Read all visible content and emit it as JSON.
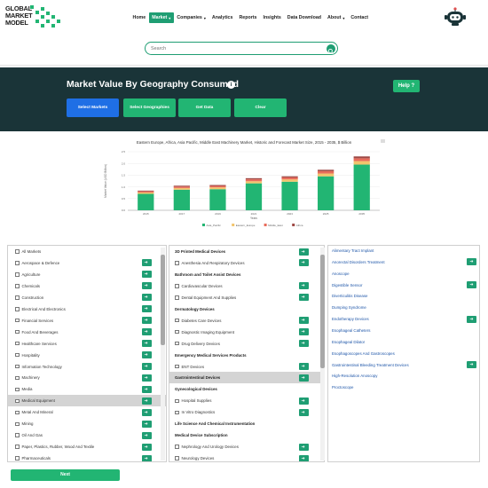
{
  "logo": {
    "line1": "GLOBAL",
    "line2": "MARKET",
    "line3": "MODEL"
  },
  "nav": [
    {
      "label": "Home",
      "dropdown": false,
      "active": false
    },
    {
      "label": "Market",
      "dropdown": true,
      "active": true
    },
    {
      "label": "Companies",
      "dropdown": true,
      "active": false
    },
    {
      "label": "Analytics",
      "dropdown": false,
      "active": false
    },
    {
      "label": "Reports",
      "dropdown": false,
      "active": false
    },
    {
      "label": "Insights",
      "dropdown": false,
      "active": false
    },
    {
      "label": "Data Download",
      "dropdown": false,
      "active": false
    },
    {
      "label": "About",
      "dropdown": true,
      "active": false
    },
    {
      "label": "Contact",
      "dropdown": false,
      "active": false
    }
  ],
  "search": {
    "placeholder": "Search",
    "value": ""
  },
  "banner": {
    "title": "Market Value By Geography Consumed",
    "info_icon": "i",
    "help_label": "Help",
    "help_icon": "?",
    "buttons": [
      {
        "label": "Select Markets",
        "color": "#1f6fe5"
      },
      {
        "label": "Select Geographies",
        "color": "#22b573"
      },
      {
        "label": "Get Data",
        "color": "#22b573"
      },
      {
        "label": "Clear",
        "color": "#22b573"
      }
    ]
  },
  "chart_data": {
    "type": "bar",
    "title": "Eastern Europe, Africa, Asia Pacific, Middle East Machinery Market, Historic and Forecast Market Size, 2015 - 2035, $ Billion",
    "xlabel": "Years",
    "ylabel": "Market Value (USD Billion)",
    "categories": [
      "2015",
      "2017",
      "2019",
      "2021",
      "2023",
      "2025",
      "2035"
    ],
    "ylim": [
      0,
      2.5
    ],
    "stacked": true,
    "legend_position": "bottom",
    "series": [
      {
        "name": "Asia_Pacific",
        "color": "#22b573",
        "values": [
          0.7,
          0.88,
          0.9,
          1.15,
          1.22,
          1.45,
          1.95
        ]
      },
      {
        "name": "Eastern_Europe",
        "color": "#f2c46d",
        "values": [
          0.06,
          0.07,
          0.08,
          0.09,
          0.1,
          0.12,
          0.15
        ]
      },
      {
        "name": "Middle_East",
        "color": "#e86c5b",
        "values": [
          0.05,
          0.06,
          0.06,
          0.08,
          0.08,
          0.1,
          0.12
        ]
      },
      {
        "name": "Africa",
        "color": "#9e4a46",
        "values": [
          0.03,
          0.04,
          0.04,
          0.05,
          0.05,
          0.06,
          0.08
        ]
      }
    ]
  },
  "markets_col1": [
    {
      "label": "All Markets",
      "arrow": false,
      "selected": false
    },
    {
      "label": "Aerospace & Defence",
      "arrow": true,
      "selected": false
    },
    {
      "label": "Agriculture",
      "arrow": true,
      "selected": false
    },
    {
      "label": "Chemicals",
      "arrow": true,
      "selected": false
    },
    {
      "label": "Construction",
      "arrow": true,
      "selected": false
    },
    {
      "label": "Electrical And Electronics",
      "arrow": true,
      "selected": false
    },
    {
      "label": "Financial Services",
      "arrow": true,
      "selected": false
    },
    {
      "label": "Food And Beverages",
      "arrow": true,
      "selected": false
    },
    {
      "label": "Healthcare Services",
      "arrow": true,
      "selected": false
    },
    {
      "label": "Hospitality",
      "arrow": true,
      "selected": false
    },
    {
      "label": "Information Technology",
      "arrow": true,
      "selected": false
    },
    {
      "label": "Machinery",
      "arrow": true,
      "selected": false
    },
    {
      "label": "Media",
      "arrow": true,
      "selected": false
    },
    {
      "label": "Medical Equipment",
      "arrow": true,
      "selected": true
    },
    {
      "label": "Metal And Mineral",
      "arrow": true,
      "selected": false
    },
    {
      "label": "Mining",
      "arrow": true,
      "selected": false
    },
    {
      "label": "Oil And Gas",
      "arrow": true,
      "selected": false
    },
    {
      "label": "Paper, Plastics, Rubber, Wood And Textile",
      "arrow": true,
      "selected": false
    },
    {
      "label": "Pharmaceuticals",
      "arrow": true,
      "selected": false
    }
  ],
  "markets_col2": [
    {
      "label": "3D Printed Medical Devices",
      "header": true,
      "arrow": true,
      "selected": false
    },
    {
      "label": "Anesthesia And Respiratory Devices",
      "header": false,
      "arrow": true,
      "selected": false
    },
    {
      "label": "Bathroom and Toilet Assist Devices",
      "header": true,
      "arrow": false,
      "selected": false
    },
    {
      "label": "Cardiovascular Devices",
      "header": false,
      "arrow": true,
      "selected": false
    },
    {
      "label": "Dental Equipment And Supplies",
      "header": false,
      "arrow": true,
      "selected": false
    },
    {
      "label": "Dermatology Devices",
      "header": true,
      "arrow": false,
      "selected": false
    },
    {
      "label": "Diabetes Care Devices",
      "header": false,
      "arrow": true,
      "selected": false
    },
    {
      "label": "Diagnostic Imaging Equipment",
      "header": false,
      "arrow": true,
      "selected": false
    },
    {
      "label": "Drug Delivery Devices",
      "header": false,
      "arrow": true,
      "selected": false
    },
    {
      "label": "Emergency Medical Services Products",
      "header": true,
      "arrow": false,
      "selected": false
    },
    {
      "label": "ENT Devices",
      "header": false,
      "arrow": true,
      "selected": false
    },
    {
      "label": "Gastrointestinal Devices",
      "header": true,
      "arrow": true,
      "selected": true
    },
    {
      "label": "Gynecological Devices",
      "header": true,
      "arrow": false,
      "selected": false
    },
    {
      "label": "Hospital Supplies",
      "header": false,
      "arrow": true,
      "selected": false
    },
    {
      "label": "In Vitro Diagnostics",
      "header": false,
      "arrow": true,
      "selected": false
    },
    {
      "label": "Life Science And Chemical Instrumentation",
      "header": true,
      "arrow": false,
      "selected": false
    },
    {
      "label": "Medical Device Subscription",
      "header": true,
      "arrow": false,
      "selected": false
    },
    {
      "label": "Nephrology And Urology Devices",
      "header": false,
      "arrow": true,
      "selected": false
    },
    {
      "label": "Neurology Devices",
      "header": false,
      "arrow": true,
      "selected": false
    }
  ],
  "markets_col3": [
    {
      "label": "Alimentary Tract Implant",
      "arrow": false
    },
    {
      "label": "Anorectal Disorders Treatment",
      "arrow": true
    },
    {
      "label": "Anoscope",
      "arrow": false
    },
    {
      "label": "Digestible Sensor",
      "arrow": true
    },
    {
      "label": "Diverticulitis Disease",
      "arrow": false
    },
    {
      "label": "Dumping Syndrome",
      "arrow": false
    },
    {
      "label": "Endotherapy Devices",
      "arrow": true
    },
    {
      "label": "Esophageal Catheters",
      "arrow": false
    },
    {
      "label": "Esophageal Dilator",
      "arrow": false
    },
    {
      "label": "Esophagoscopes And Gastroscopes",
      "arrow": false
    },
    {
      "label": "Gastrointestinal Bleeding Treatment Devices",
      "arrow": true
    },
    {
      "label": "High-Resolution Anoscopy",
      "arrow": false
    },
    {
      "label": "Proctoscope",
      "arrow": false
    }
  ],
  "next_label": "Next"
}
